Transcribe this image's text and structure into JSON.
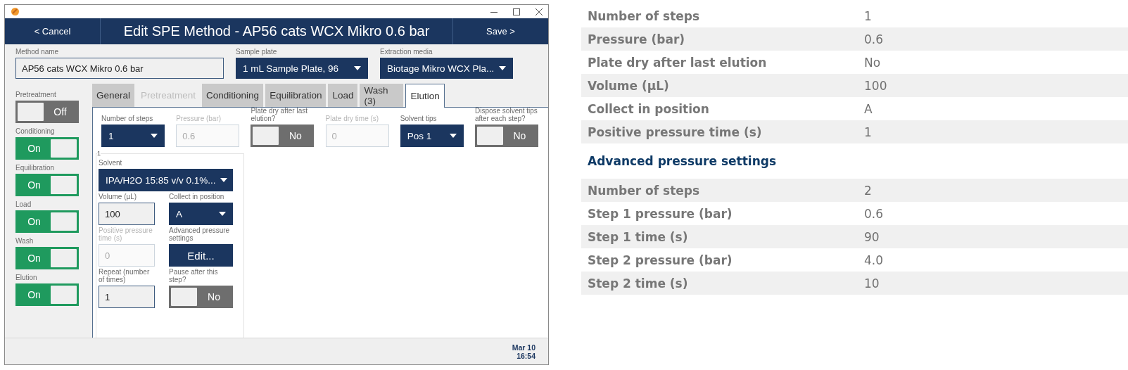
{
  "header": {
    "cancel": "< Cancel",
    "title": "Edit SPE Method - AP56 cats WCX Mikro 0.6 bar",
    "save": "Save >"
  },
  "top_fields": [
    {
      "kind": "text",
      "label": "Method name",
      "value": "AP56 cats WCX Mikro 0.6 bar"
    },
    {
      "kind": "dropdown",
      "label": "Sample plate",
      "value": "1 mL Sample Plate, 96"
    },
    {
      "kind": "dropdown",
      "label": "Extraction media",
      "value": "Biotage Mikro WCX Pla..."
    }
  ],
  "stages": [
    {
      "label": "Pretreatment",
      "on": false,
      "state_text": "Off"
    },
    {
      "label": "Conditioning",
      "on": true,
      "state_text": "On"
    },
    {
      "label": "Equilibration",
      "on": true,
      "state_text": "On"
    },
    {
      "label": "Load",
      "on": true,
      "state_text": "On"
    },
    {
      "label": "Wash",
      "on": true,
      "state_text": "On"
    },
    {
      "label": "Elution",
      "on": true,
      "state_text": "On"
    }
  ],
  "tabs": [
    {
      "label": "General",
      "selected": false,
      "disabled": false
    },
    {
      "label": "Pretreatment",
      "selected": false,
      "disabled": true
    },
    {
      "label": "Conditioning",
      "selected": false,
      "disabled": false
    },
    {
      "label": "Equilibration",
      "selected": false,
      "disabled": false
    },
    {
      "label": "Load",
      "selected": false,
      "disabled": false
    },
    {
      "label": "Wash (3)",
      "selected": false,
      "disabled": false
    },
    {
      "label": "Elution",
      "selected": true,
      "disabled": false
    }
  ],
  "elution_controls": [
    {
      "kind": "dropdown",
      "label": "Number of steps",
      "value": "1"
    },
    {
      "kind": "text",
      "label": "Pressure (bar)",
      "value": "0.6",
      "disabled": true
    },
    {
      "kind": "toggle",
      "label": "Plate dry after last elution?",
      "on": false,
      "state_text": "No"
    },
    {
      "kind": "text",
      "label": "Plate dry time (s)",
      "value": "0",
      "disabled": true
    },
    {
      "kind": "dropdown",
      "label": "Solvent tips",
      "value": "Pos 1"
    },
    {
      "kind": "toggle",
      "label": "Dispose solvent tips after each step?",
      "on": false,
      "state_text": "No"
    }
  ],
  "step": {
    "number": "1",
    "controls": [
      {
        "kind": "dropdown",
        "label": "Solvent",
        "value": "IPA/H2O 15:85 v/v 0.1%..."
      },
      {
        "kind": "text",
        "label": "Volume (µL)",
        "value": "100",
        "disabled": false
      },
      {
        "kind": "dropdown",
        "label": "Collect in position",
        "value": "A"
      },
      {
        "kind": "text",
        "label": "Positive pressure time (s)",
        "value": "0",
        "disabled": true
      },
      {
        "kind": "button",
        "label": "Advanced pressure settings",
        "value": "Edit..."
      },
      {
        "kind": "text",
        "label": "Repeat (number of times)",
        "value": "1",
        "disabled": false
      },
      {
        "kind": "toggle",
        "label": "Pause after this step?",
        "on": false,
        "state_text": "No"
      }
    ]
  },
  "footer": {
    "date": "Mar 10",
    "time": "16:54"
  },
  "summary": {
    "rows": [
      {
        "label": "Number of steps",
        "value": "1"
      },
      {
        "label": "Pressure (bar)",
        "value": "0.6"
      },
      {
        "label": "Plate dry after last elution",
        "value": "No"
      },
      {
        "label": "Volume (µL)",
        "value": "100"
      },
      {
        "label": "Collect in position",
        "value": "A"
      },
      {
        "label": "Positive pressure time (s)",
        "value": "1"
      }
    ],
    "advanced_heading": "Advanced pressure settings",
    "advanced_rows": [
      {
        "label": "Number of steps",
        "value": "2"
      },
      {
        "label": "Step 1 pressure (bar)",
        "value": "0.6"
      },
      {
        "label": "Step 1 time (s)",
        "value": "90"
      },
      {
        "label": "Step 2 pressure (bar)",
        "value": "4.0"
      },
      {
        "label": "Step 2 time (s)",
        "value": "10"
      }
    ]
  }
}
